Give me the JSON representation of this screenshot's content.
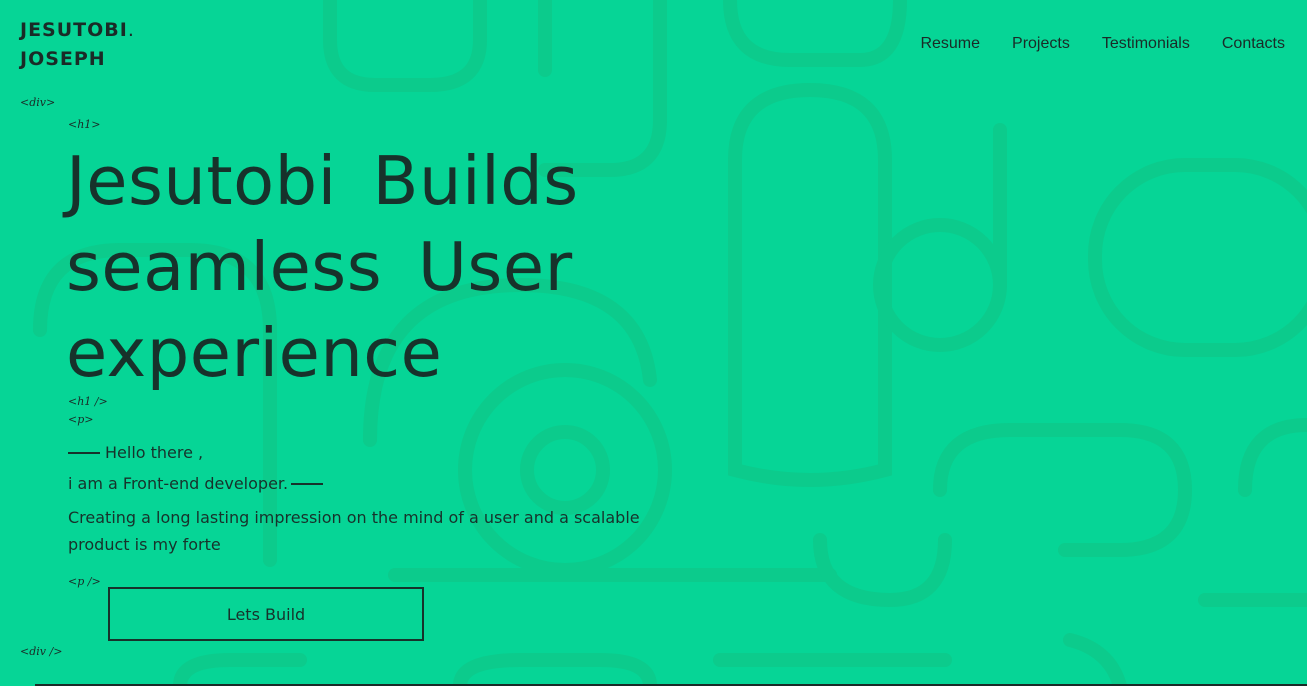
{
  "logo": {
    "line1": "JESUTOBI",
    "dot": ".",
    "line2": "JOSEPH"
  },
  "nav": [
    {
      "label": "Resume"
    },
    {
      "label": "Projects"
    },
    {
      "label": "Testimonials"
    },
    {
      "label": "Contacts"
    }
  ],
  "tags": {
    "div_open": "<div>",
    "h1_open": "<h1>",
    "h1_close": "<h1 />",
    "p_open": "<p>",
    "p_close": "<p />",
    "div_close": "<div />"
  },
  "hero": {
    "title_line1": "Jesutobi Builds",
    "title_line2": "seamless User",
    "title_line3": "experience",
    "greeting": "Hello there ,",
    "role": "i am a Front-end developer.",
    "description": "Creating a long lasting impression on the mind of a user and a scalable product is my forte",
    "cta_label": "Lets Build"
  },
  "colors": {
    "background": "#06d596",
    "text": "#17322b",
    "pattern": "#0ccb8c"
  }
}
